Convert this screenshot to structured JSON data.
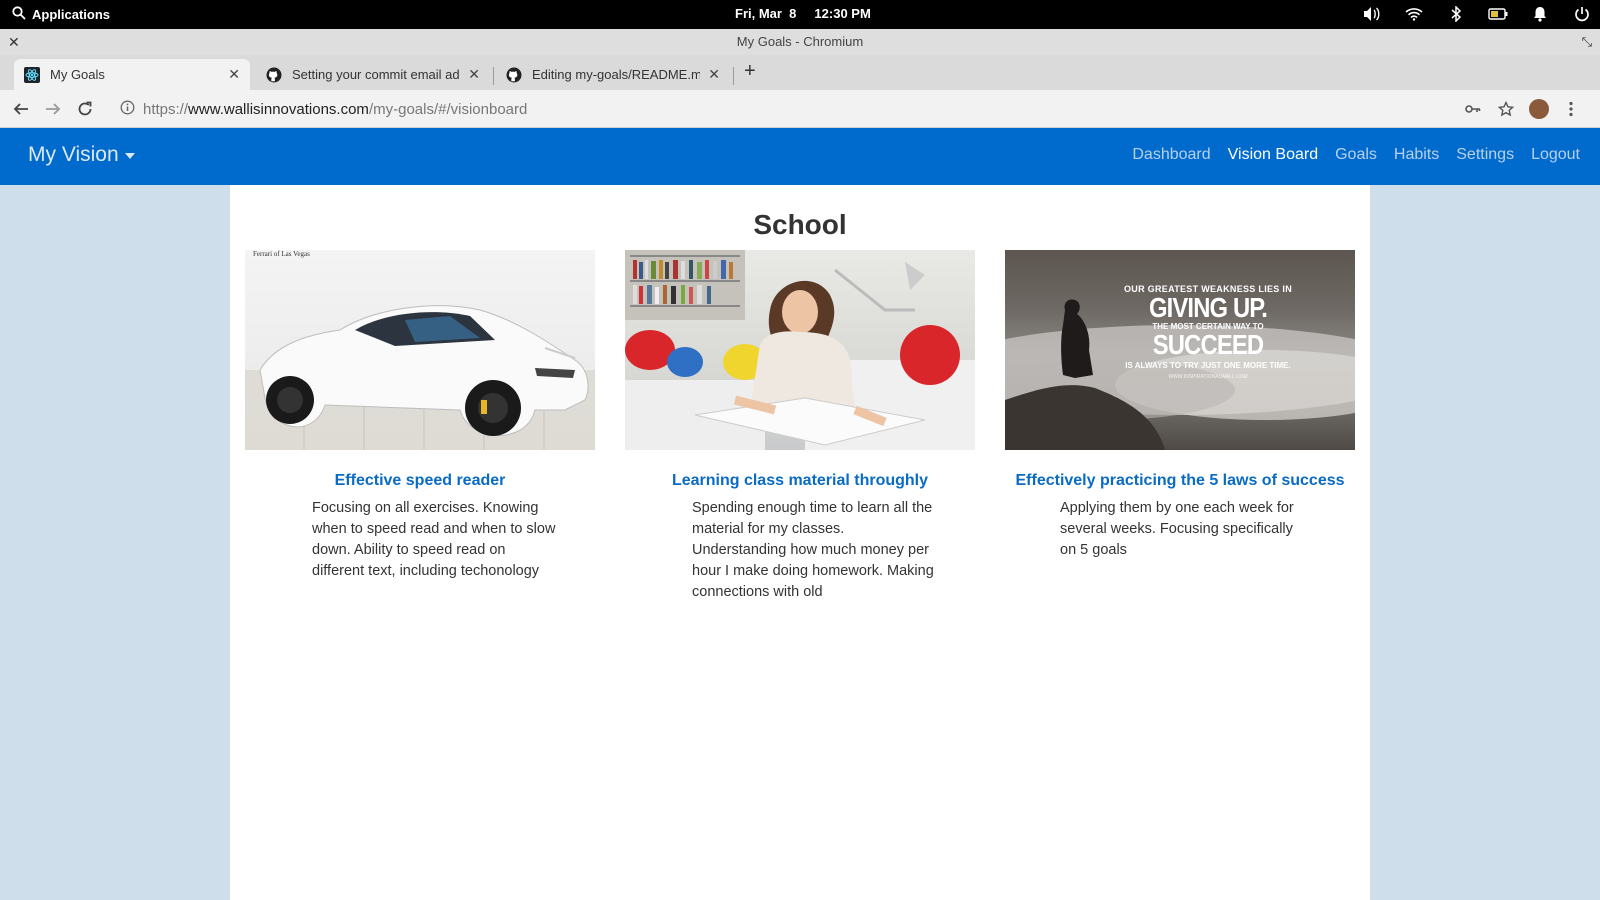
{
  "os": {
    "apps_label": "Applications",
    "date": "Fri, Mar  8",
    "time": "12:30 PM"
  },
  "window": {
    "title": "My Goals - Chromium"
  },
  "tabs": [
    {
      "label": "My Goals",
      "icon": "react-icon"
    },
    {
      "label": "Setting your commit email addr",
      "icon": "github-icon"
    },
    {
      "label": "Editing my-goals/README.md a",
      "icon": "github-icon"
    }
  ],
  "address": {
    "scheme": "https://",
    "host": "www.wallisinnovations.com",
    "path": "/my-goals/#/visionboard"
  },
  "app": {
    "brand": "My Vision",
    "nav": [
      "Dashboard",
      "Vision Board",
      "Goals",
      "Habits",
      "Settings",
      "Logout"
    ],
    "active_nav": "Vision Board"
  },
  "board": {
    "section_title": "School",
    "cards": [
      {
        "title": "Effective speed reader",
        "description": "Focusing on all exercises. Knowing when to speed read and when to slow down. Ability to speed read on different text, including techonology",
        "image_caption": "Ferrari of Las Vegas"
      },
      {
        "title": "Learning class material throughly",
        "description": "Spending enough time to learn all the material for my classes. Understanding how much money per hour I make doing homework. Making connections with old"
      },
      {
        "title": "Effectively practicing the 5 laws of success",
        "description": "Applying them by one each week for several weeks. Focusing specifically on 5 goals",
        "quote": {
          "line1": "OUR GREATEST WEAKNESS LIES IN",
          "big1": "GIVING UP.",
          "line2": "THE MOST CERTAIN WAY TO",
          "big2": "SUCCEED",
          "line3": "IS ALWAYS TO TRY JUST ONE MORE TIME.",
          "source": "WWW.INSPIRATIONALWALL.COM"
        }
      }
    ]
  },
  "colors": {
    "app_bar": "#006bcc",
    "link": "#0a6bc4",
    "page_bg": "#cfdeeb"
  }
}
